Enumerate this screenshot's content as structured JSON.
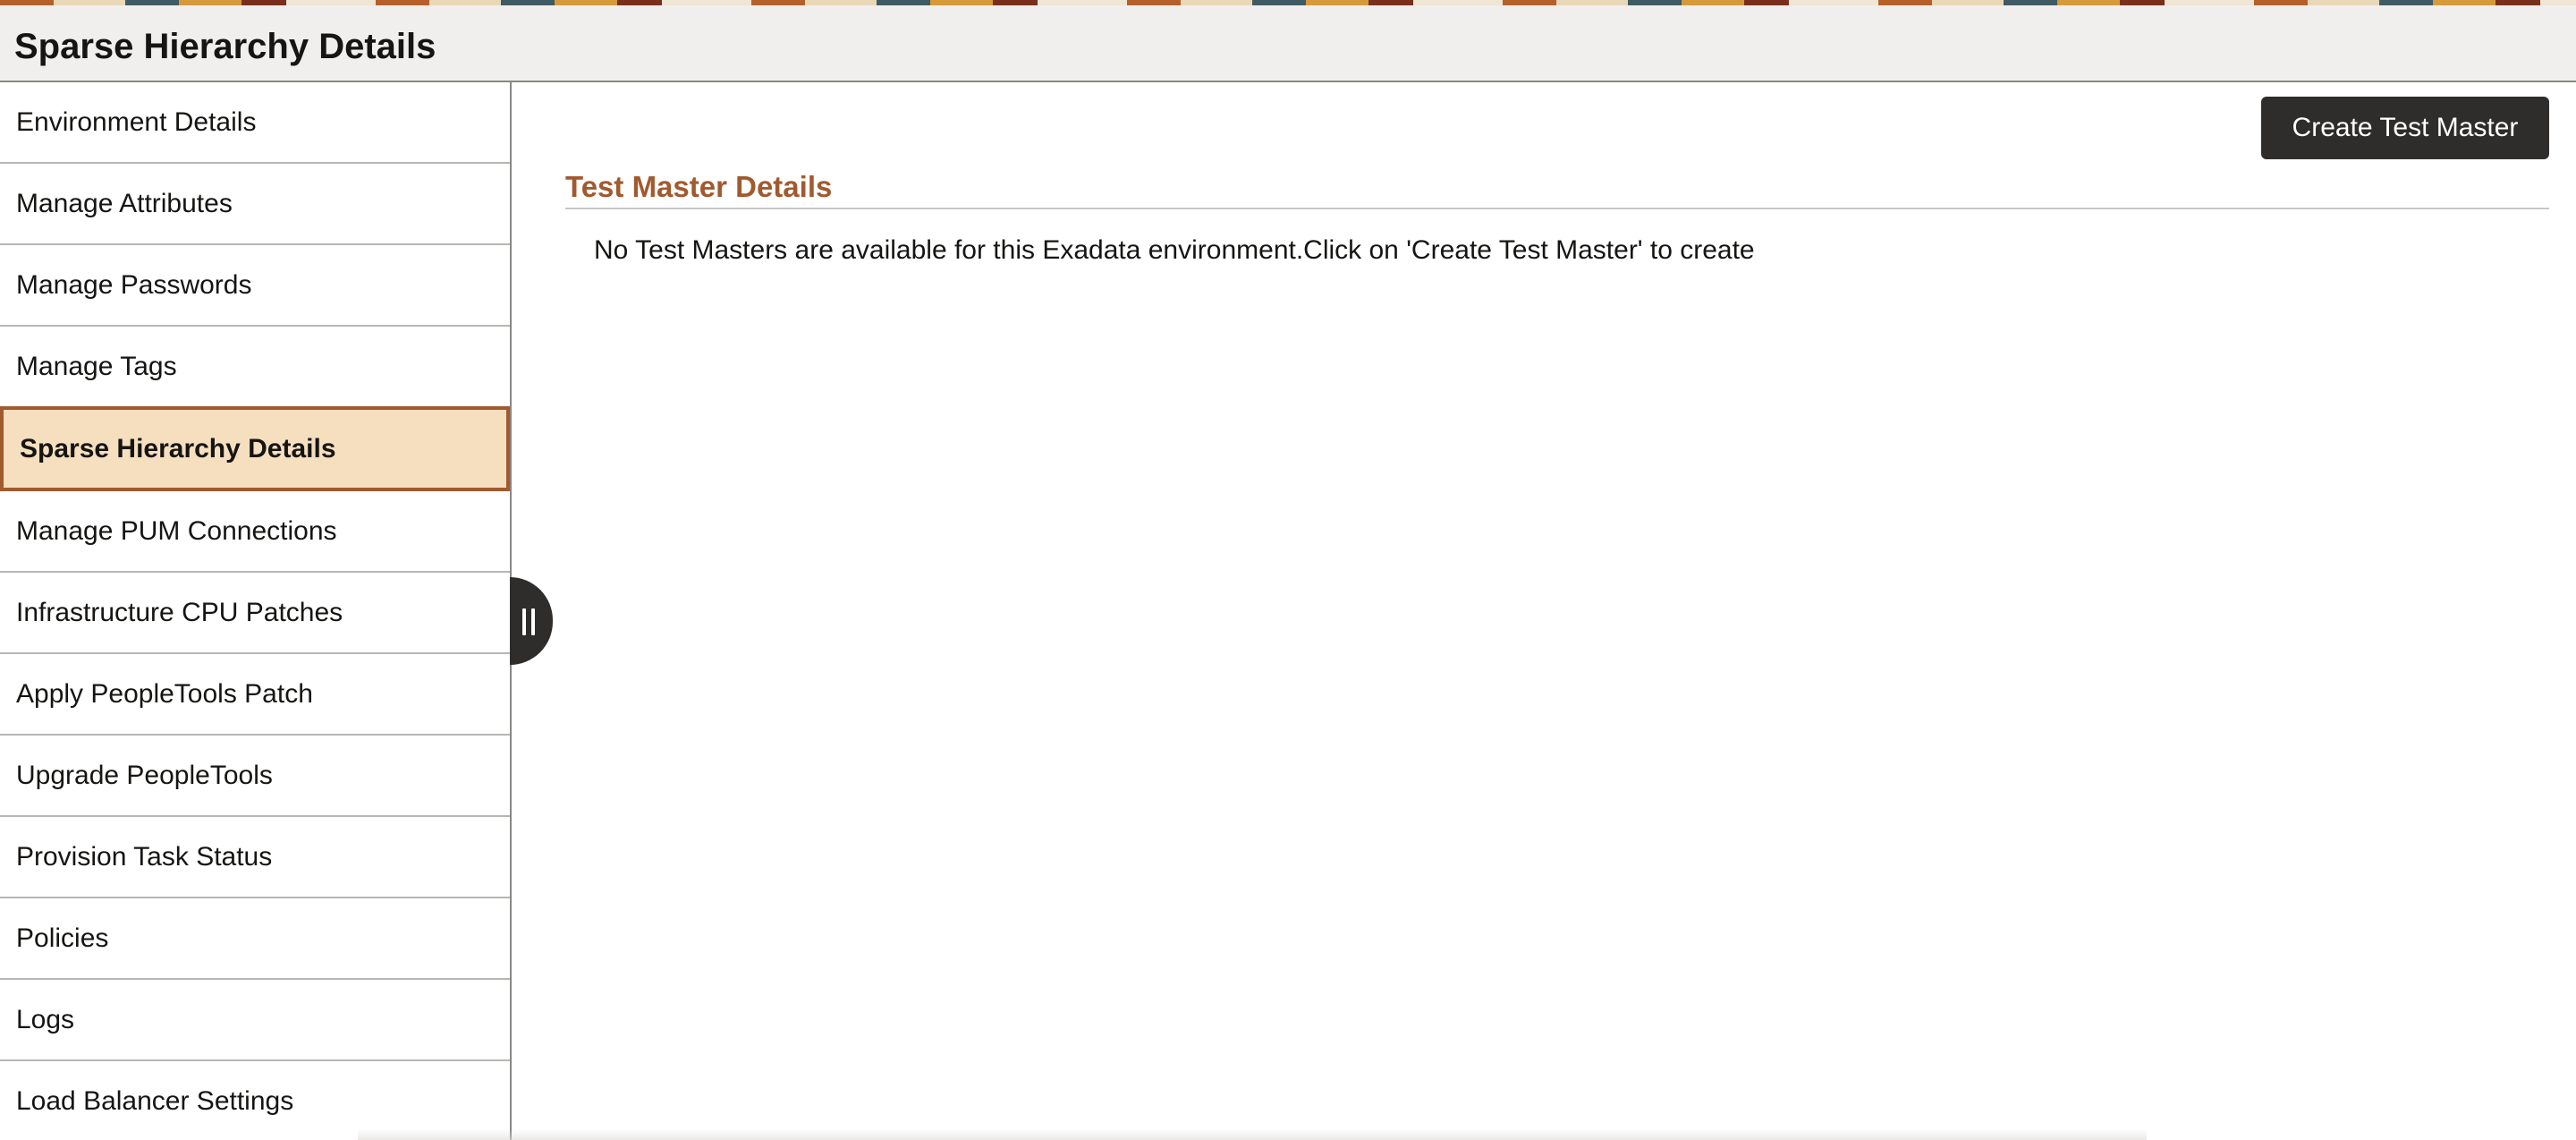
{
  "header": {
    "title": "Sparse Hierarchy Details"
  },
  "sidebar": {
    "active_index": 4,
    "items": [
      {
        "label": "Environment Details"
      },
      {
        "label": "Manage Attributes"
      },
      {
        "label": "Manage Passwords"
      },
      {
        "label": "Manage Tags"
      },
      {
        "label": "Sparse Hierarchy Details"
      },
      {
        "label": "Manage PUM Connections"
      },
      {
        "label": "Infrastructure CPU Patches"
      },
      {
        "label": "Apply PeopleTools Patch"
      },
      {
        "label": "Upgrade PeopleTools"
      },
      {
        "label": "Provision Task Status"
      },
      {
        "label": "Policies"
      },
      {
        "label": "Logs"
      },
      {
        "label": "Load Balancer Settings"
      }
    ]
  },
  "main": {
    "create_button_label": "Create Test Master",
    "section_title": "Test Master Details",
    "empty_message": "No Test Masters are available for this Exadata environment.Click on 'Create Test Master' to create"
  },
  "colors": {
    "accent": "#a15a2f",
    "active_bg": "#f5dfbf",
    "button_bg": "#2e2d2b",
    "header_bg": "#f1efed"
  },
  "icons": {
    "collapse_handle": "pause-grip-icon"
  }
}
